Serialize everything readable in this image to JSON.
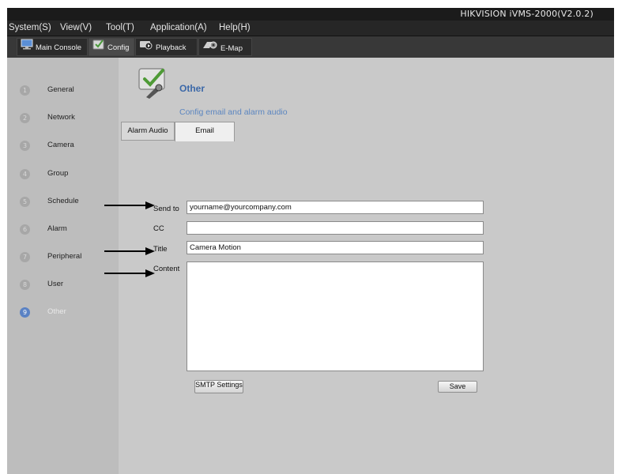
{
  "window": {
    "title": "HIKVISION iVMS-2000(V2.0.2)"
  },
  "menu": [
    {
      "label": "System(S)",
      "key": "system"
    },
    {
      "label": "View(V)",
      "key": "view"
    },
    {
      "label": "Tool(T)",
      "key": "tool"
    },
    {
      "label": "Application(A)",
      "key": "application"
    },
    {
      "label": "Help(H)",
      "key": "help"
    }
  ],
  "toolbar": {
    "tabs": [
      {
        "label": "Main Console",
        "icon": "monitor-icon"
      },
      {
        "label": "Config",
        "icon": "config-check-icon",
        "active": true
      },
      {
        "label": "Playback",
        "icon": "playback-camera-icon"
      },
      {
        "label": "E-Map",
        "icon": "emap-gear-icon"
      }
    ]
  },
  "sidebar": {
    "items": [
      {
        "num": "1",
        "label": "General"
      },
      {
        "num": "2",
        "label": "Network"
      },
      {
        "num": "3",
        "label": "Camera"
      },
      {
        "num": "4",
        "label": "Group"
      },
      {
        "num": "5",
        "label": "Schedule"
      },
      {
        "num": "6",
        "label": "Alarm"
      },
      {
        "num": "7",
        "label": "Peripheral"
      },
      {
        "num": "8",
        "label": "User"
      },
      {
        "num": "9",
        "label": "Other",
        "active": true
      }
    ]
  },
  "page": {
    "title": "Other",
    "subtitle": "Config email and alarm audio",
    "icon": "config-check-icon"
  },
  "tabs": [
    {
      "label": "Alarm Audio",
      "active": false
    },
    {
      "label": "Email",
      "active": true
    }
  ],
  "email_form": {
    "send_to": {
      "label": "Send to",
      "value": "yourname@yourcompany.com"
    },
    "cc": {
      "label": "CC",
      "value": ""
    },
    "title": {
      "label": "Title",
      "value": "Camera Motion"
    },
    "content": {
      "label": "Content",
      "value": ""
    },
    "smtp_button": "SMTP Settings",
    "save_button": "Save"
  },
  "colors": {
    "accent": "#3b68a8",
    "active_step": "#5a82c4",
    "menu_bar": "#262626",
    "panel": "#c9c9c9",
    "sidebar": "#bdbdbd"
  }
}
